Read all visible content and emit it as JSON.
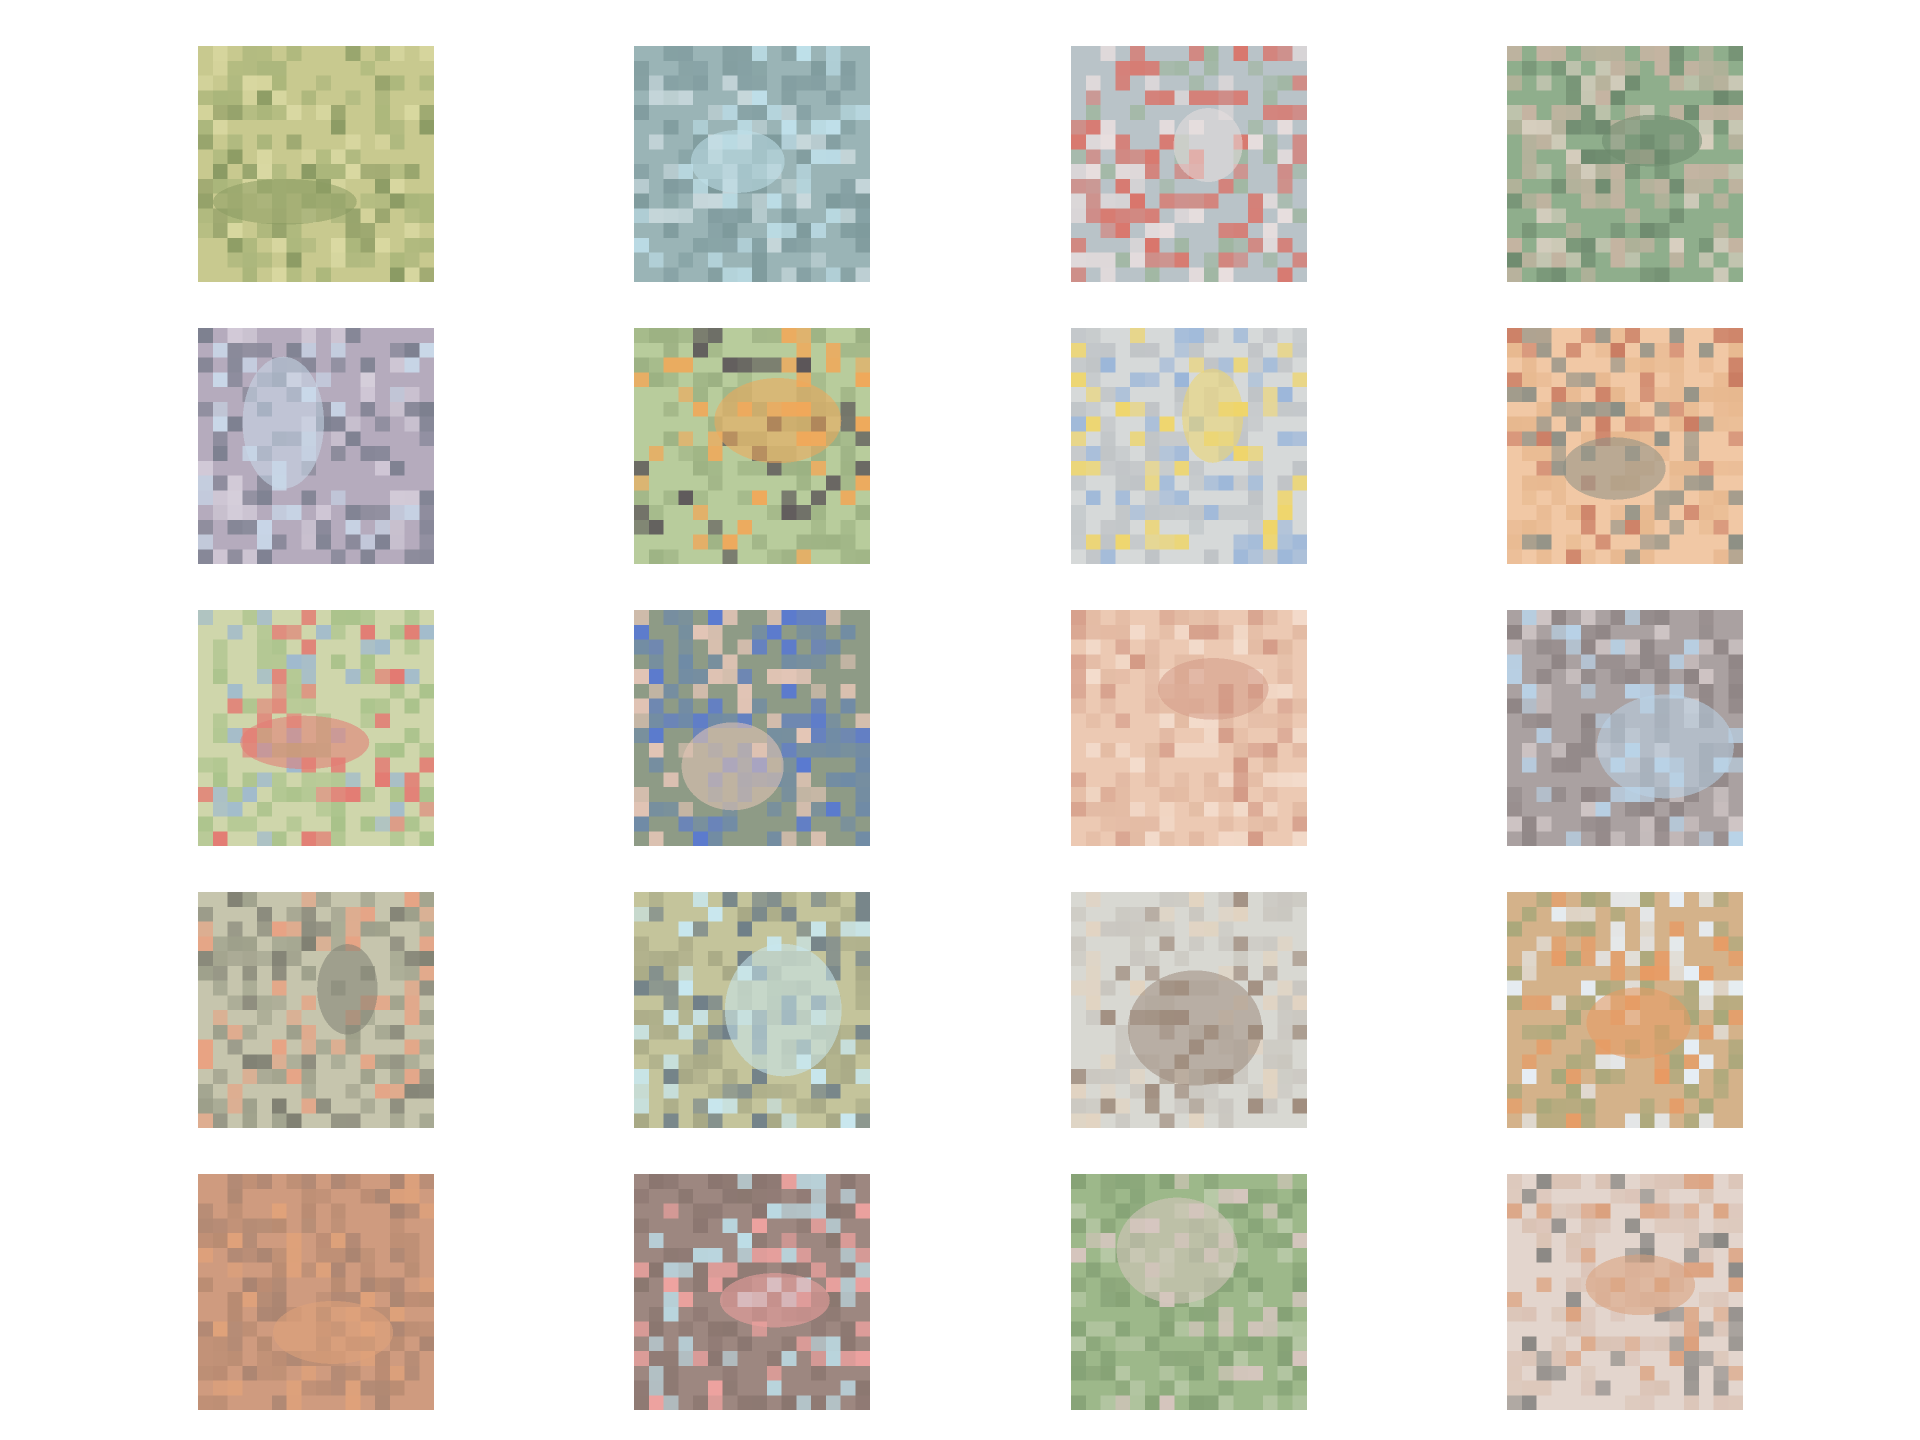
{
  "grid": {
    "rows": 5,
    "columns": 4,
    "images": [
      {
        "row": 1,
        "col": 1,
        "palette": {
          "base": "#c8c98f",
          "mid": "#a9b57a",
          "accent": "#8a9a63",
          "hi": "#dad9a2"
        }
      },
      {
        "row": 1,
        "col": 2,
        "palette": {
          "base": "#9ab4b6",
          "mid": "#7e9a9c",
          "accent": "#bfe0ea",
          "hi": "#c8d8dc"
        }
      },
      {
        "row": 1,
        "col": 3,
        "palette": {
          "base": "#b9c3c8",
          "mid": "#d9766c",
          "accent": "#e8dede",
          "hi": "#9fb6a0"
        }
      },
      {
        "row": 1,
        "col": 4,
        "palette": {
          "base": "#8fae8c",
          "mid": "#c5b4a2",
          "accent": "#6e8a6e",
          "hi": "#d9cfc0"
        }
      },
      {
        "row": 2,
        "col": 1,
        "palette": {
          "base": "#b5abbd",
          "mid": "#7c7f8f",
          "accent": "#c9d8e9",
          "hi": "#d6cedb"
        }
      },
      {
        "row": 2,
        "col": 2,
        "palette": {
          "base": "#b8cc9c",
          "mid": "#9cb183",
          "accent": "#f0a85a",
          "hi": "#5a5458"
        }
      },
      {
        "row": 2,
        "col": 3,
        "palette": {
          "base": "#d6d9d9",
          "mid": "#bfc3c6",
          "accent": "#efd56a",
          "hi": "#9bb6d9"
        }
      },
      {
        "row": 2,
        "col": 4,
        "palette": {
          "base": "#f1c8a5",
          "mid": "#e7b88f",
          "accent": "#8c8f85",
          "hi": "#c97b62"
        }
      },
      {
        "row": 3,
        "col": 1,
        "palette": {
          "base": "#cfd6ab",
          "mid": "#a9c28a",
          "accent": "#e37a72",
          "hi": "#9bb7d1"
        }
      },
      {
        "row": 3,
        "col": 2,
        "palette": {
          "base": "#8e9b86",
          "mid": "#6e8aa8",
          "accent": "#e7c7b8",
          "hi": "#5a7ad0"
        }
      },
      {
        "row": 3,
        "col": 3,
        "palette": {
          "base": "#ecc9b3",
          "mid": "#e2b9a2",
          "accent": "#d39a86",
          "hi": "#f3dccc"
        }
      },
      {
        "row": 3,
        "col": 4,
        "palette": {
          "base": "#aaa1a1",
          "mid": "#8f8585",
          "accent": "#b9d3e8",
          "hi": "#cfc5c5"
        }
      },
      {
        "row": 4,
        "col": 1,
        "palette": {
          "base": "#c6c5ad",
          "mid": "#9d9f8a",
          "accent": "#7f7f72",
          "hi": "#e8a283"
        }
      },
      {
        "row": 4,
        "col": 2,
        "palette": {
          "base": "#c4c49b",
          "mid": "#a7a885",
          "accent": "#c8e7ef",
          "hi": "#6e7e88"
        }
      },
      {
        "row": 4,
        "col": 3,
        "palette": {
          "base": "#d8d8d2",
          "mid": "#c9c6bf",
          "accent": "#9f8c7d",
          "hi": "#e2d3c0"
        }
      },
      {
        "row": 4,
        "col": 4,
        "palette": {
          "base": "#d4b28a",
          "mid": "#a7a77a",
          "accent": "#e89a63",
          "hi": "#e6eef5"
        }
      },
      {
        "row": 5,
        "col": 1,
        "palette": {
          "base": "#cf9b7f",
          "mid": "#b88b72",
          "accent": "#e0a27a",
          "hi": "#a98471"
        }
      },
      {
        "row": 5,
        "col": 2,
        "palette": {
          "base": "#9d8780",
          "mid": "#8a766f",
          "accent": "#f0a3a0",
          "hi": "#bfe3ee"
        }
      },
      {
        "row": 5,
        "col": 3,
        "palette": {
          "base": "#9db88a",
          "mid": "#86a276",
          "accent": "#d7c6c0",
          "hi": "#b9c9a8"
        }
      },
      {
        "row": 5,
        "col": 4,
        "palette": {
          "base": "#e3d5cd",
          "mid": "#dac2b4",
          "accent": "#dba07c",
          "hi": "#8a8884"
        }
      }
    ]
  }
}
